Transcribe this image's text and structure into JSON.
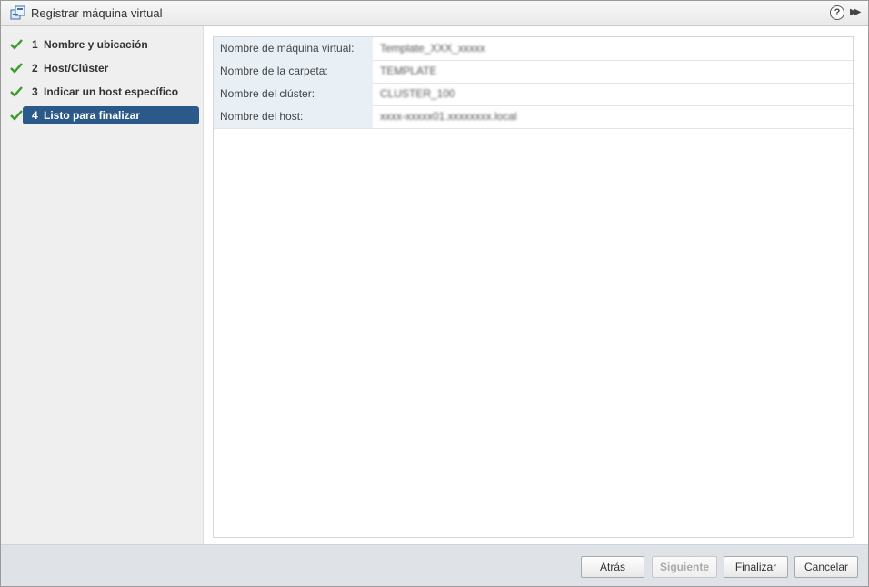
{
  "window": {
    "title": "Registrar máquina virtual",
    "icons": [
      "vm-register-icon",
      "help-icon",
      "expand-icon"
    ]
  },
  "steps": [
    {
      "number": "1",
      "label": "Nombre y ubicación",
      "done": true
    },
    {
      "number": "2",
      "label": "Host/Clúster",
      "done": true
    },
    {
      "number": "3",
      "label": "Indicar un host específico",
      "done": true
    },
    {
      "number": "4",
      "label": "Listo para finalizar",
      "done": true,
      "active": true
    }
  ],
  "summary": [
    {
      "label": "Nombre de máquina virtual:",
      "value": "Template_XXX_xxxxx"
    },
    {
      "label": "Nombre de la carpeta:",
      "value": "TEMPLATE"
    },
    {
      "label": "Nombre del clúster:",
      "value": "CLUSTER_100"
    },
    {
      "label": "Nombre del host:",
      "value": "xxxx-xxxxx01.xxxxxxxx.local"
    }
  ],
  "buttons": {
    "back": "Atrás",
    "next": "Siguiente",
    "finish": "Finalizar",
    "cancel": "Cancelar"
  },
  "colors": {
    "active_step": "#2b5a8a",
    "check": "#3a9a2a",
    "label_cell": "#e8f0f6",
    "footer": "#dfe3e8"
  }
}
